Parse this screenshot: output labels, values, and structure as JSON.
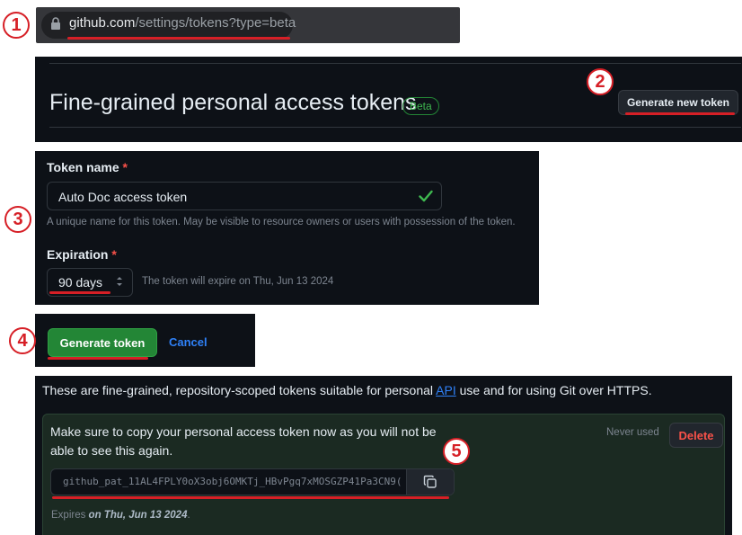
{
  "colors": {
    "annotation": "#d61f26",
    "accent_green": "#238636",
    "link": "#2f81f7",
    "danger": "#f85149"
  },
  "browser": {
    "url_host": "github.com",
    "url_path": "/settings/tokens?type=beta",
    "lock_icon": "lock-icon"
  },
  "annotations": [
    "1",
    "2",
    "3",
    "4",
    "5"
  ],
  "header": {
    "title": "Fine-grained personal access tokens",
    "badge": "Beta",
    "generate_new_label": "Generate new token"
  },
  "form": {
    "name_label": "Token name",
    "required_mark": "*",
    "name_value": "Auto Doc access token",
    "name_hint": "A unique name for this token. May be visible to resource owners or users with possession of the token.",
    "expiration_label": "Expiration",
    "expiration_value": "90 days",
    "expiration_hint": "The token will expire on Thu, Jun 13 2024"
  },
  "actions": {
    "generate_label": "Generate token",
    "cancel_label": "Cancel"
  },
  "result": {
    "intro_before": "These are fine-grained, repository-scoped tokens suitable for personal ",
    "intro_link": "API",
    "intro_after": " use and for using Git over HTTPS.",
    "warning": "Make sure to copy your personal access token now as you will not be able to see this again.",
    "never_used": "Never used",
    "delete_label": "Delete",
    "token_value": "github_pat_11AL4FPLY0oX3obj6OMKTj_HBvPgq7xMOSGZP41Pa3CN9(",
    "copy_icon": "copy-icon",
    "expires_prefix": "Expires ",
    "expires_date": "on Thu, Jun 13 2024",
    "expires_suffix": "."
  }
}
